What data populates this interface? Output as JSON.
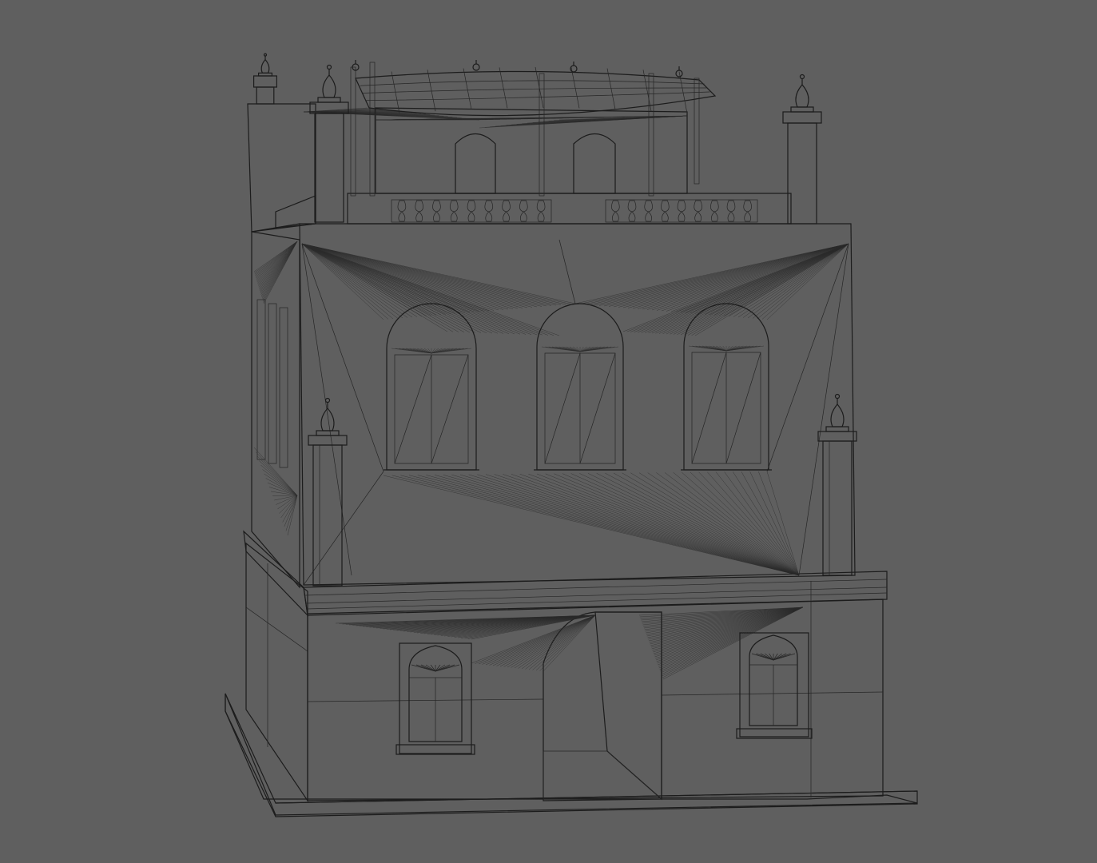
{
  "scene": {
    "background": "#5f5f5f",
    "model_fill": "#8e8e8e",
    "model_fill_light": "#a3a3a3",
    "model_fill_dark": "#6e6e6e",
    "wire_color": "#1c1c1c"
  }
}
